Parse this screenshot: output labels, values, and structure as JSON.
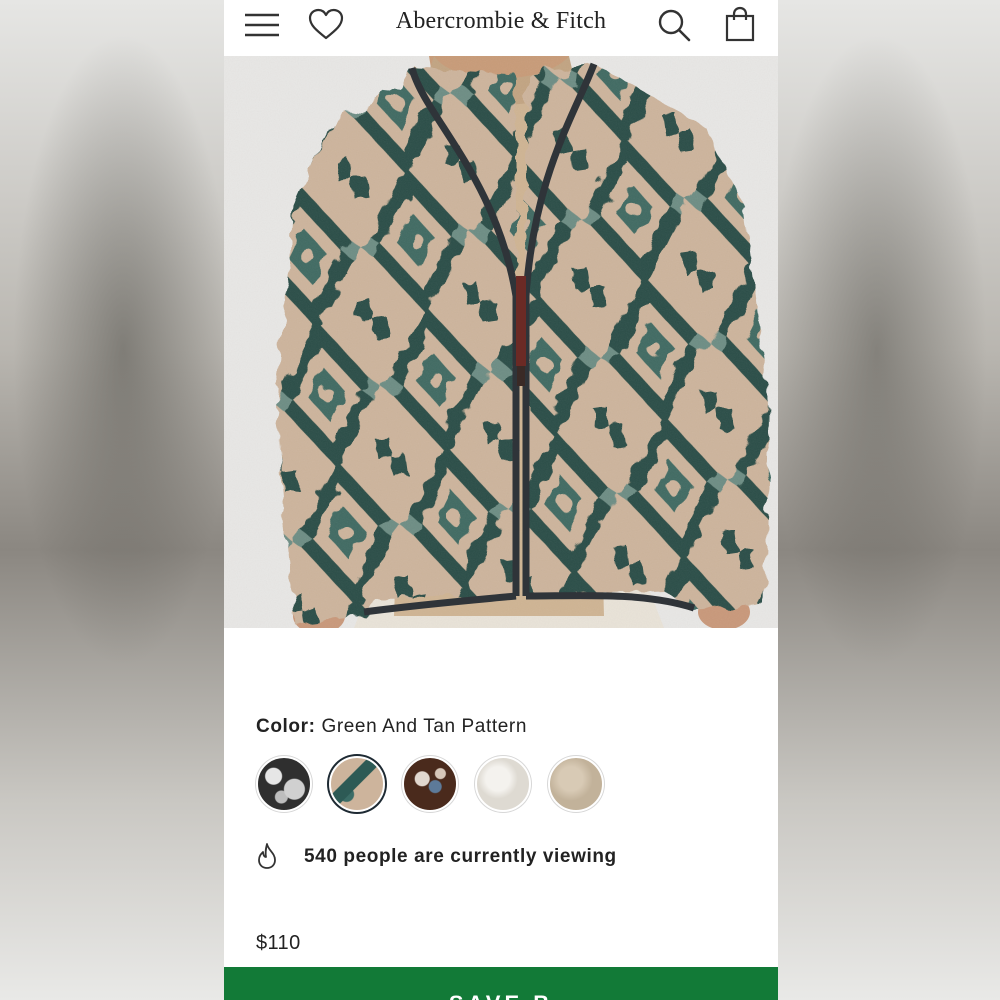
{
  "header": {
    "brand": "Abercrombie & Fitch",
    "icons": [
      "menu-icon",
      "heart-icon",
      "search-icon",
      "shopping-bag-icon"
    ]
  },
  "product": {
    "image_alt": "Sherpa jacket in green and tan pattern",
    "color_label": "Color:",
    "color_value": "Green And Tan Pattern",
    "swatches": [
      {
        "name": "Black Pattern",
        "color": "#3f3f3f"
      },
      {
        "name": "Green And Tan Pattern",
        "color": "#2f5a55",
        "selected": true
      },
      {
        "name": "Brown Pattern",
        "color": "#4a2a1c"
      },
      {
        "name": "Cream",
        "color": "#e6e3dc"
      },
      {
        "name": "Tan",
        "color": "#c9b9a2"
      }
    ],
    "viewing_text": "540 people are currently viewing",
    "price": "$110"
  },
  "cta": {
    "label": "SAVE B"
  },
  "colors": {
    "cta_green": "#127a37",
    "text": "#222222",
    "selected_ring": "#1e2a33"
  }
}
